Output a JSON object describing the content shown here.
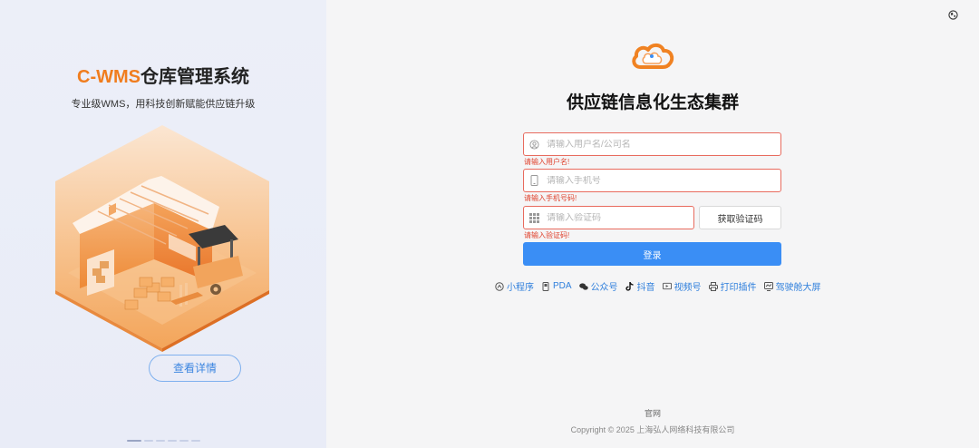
{
  "brand": {
    "accent": "C-WMS",
    "rest": "仓库管理系统",
    "accent_color": "#f07d1e"
  },
  "slogan": "专业级WMS，用科技创新赋能供应链升级",
  "detail_button": "查看详情",
  "carousel": {
    "count": 6,
    "active_index": 0
  },
  "title": "供应链信息化生态集群",
  "form": {
    "username": {
      "placeholder": "请输入用户名/公司名",
      "value": "",
      "error": "请输入用户名!",
      "icon": "user-icon"
    },
    "phone": {
      "placeholder": "请输入手机号",
      "value": "",
      "error": "请输入手机号码!",
      "icon": "phone-icon"
    },
    "code": {
      "placeholder": "请输入验证码",
      "value": "",
      "error": "请输入验证码!",
      "icon": "keypad-icon"
    },
    "get_code_label": "获取验证码",
    "login_label": "登录"
  },
  "links": [
    {
      "label": "小程序",
      "icon": "miniprogram-icon"
    },
    {
      "label": "PDA",
      "icon": "pda-icon"
    },
    {
      "label": "公众号",
      "icon": "wechat-icon"
    },
    {
      "label": "抖音",
      "icon": "douyin-icon"
    },
    {
      "label": "视频号",
      "icon": "video-icon"
    },
    {
      "label": "打印插件",
      "icon": "printer-icon"
    },
    {
      "label": "驾驶舱大屏",
      "icon": "dashboard-icon"
    }
  ],
  "footer": {
    "official_site": "官网",
    "copyright": "Copyright © 2025 上海弘人网络科技有限公司"
  },
  "colors": {
    "primary": "#3a8ef5",
    "error": "#e0422d",
    "accent": "#f07d1e"
  }
}
